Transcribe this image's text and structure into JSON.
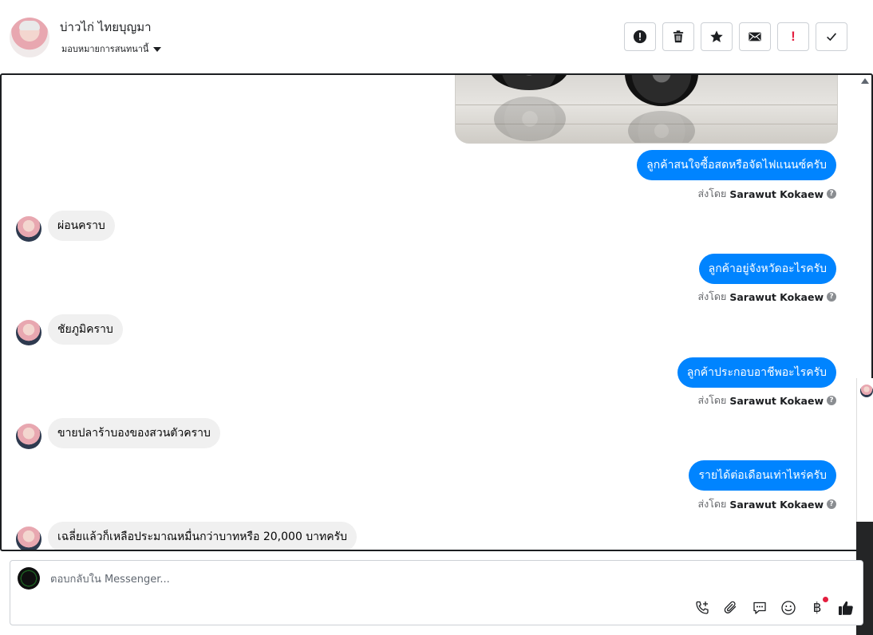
{
  "header": {
    "contact_name": "บ่าวไก่ ไทยบุญมา",
    "assign_label": "มอบหมายการสนทนานี้"
  },
  "toolbar": {
    "buttons": [
      {
        "name": "report",
        "icon": "exclamation-circle-icon"
      },
      {
        "name": "delete",
        "icon": "trash-icon"
      },
      {
        "name": "star",
        "icon": "star-icon"
      },
      {
        "name": "unread",
        "icon": "envelope-icon"
      },
      {
        "name": "spam",
        "label": "!"
      },
      {
        "name": "done",
        "icon": "check-icon"
      }
    ]
  },
  "messages": {
    "out1": "ลูกค้าสนใจซื้อสดหรือจัดไฟแนนซ์ครับ",
    "out2": "ลูกค้าอยู่จังหวัดอะไรครับ",
    "out3": "ลูกค้าประกอบอาชีพอะไรครับ",
    "out4": "รายได้ต่อเดือนเท่าไหร่ครับ",
    "in1": "ผ่อนคราบ",
    "in2": "ชัยภูมิคราบ",
    "in3": "ขายปลาร้าบองของสวนตัวคราบ",
    "in4": "เฉลี่ยแล้วก็เหลือประมาณหมื่นกว่าบาทหรือ 20,000 บาทครับ",
    "sent_by_prefix": "ส่งโดย",
    "sent_by_name": "Sarawut Kokaew",
    "help_glyph": "?"
  },
  "composer": {
    "placeholder": "ตอบกลับใน Messenger...",
    "baht_symbol": "฿"
  },
  "colors": {
    "outgoing_bubble": "#0084ff",
    "incoming_bubble": "#f0f0f0",
    "alert_red": "#e41e3f"
  }
}
